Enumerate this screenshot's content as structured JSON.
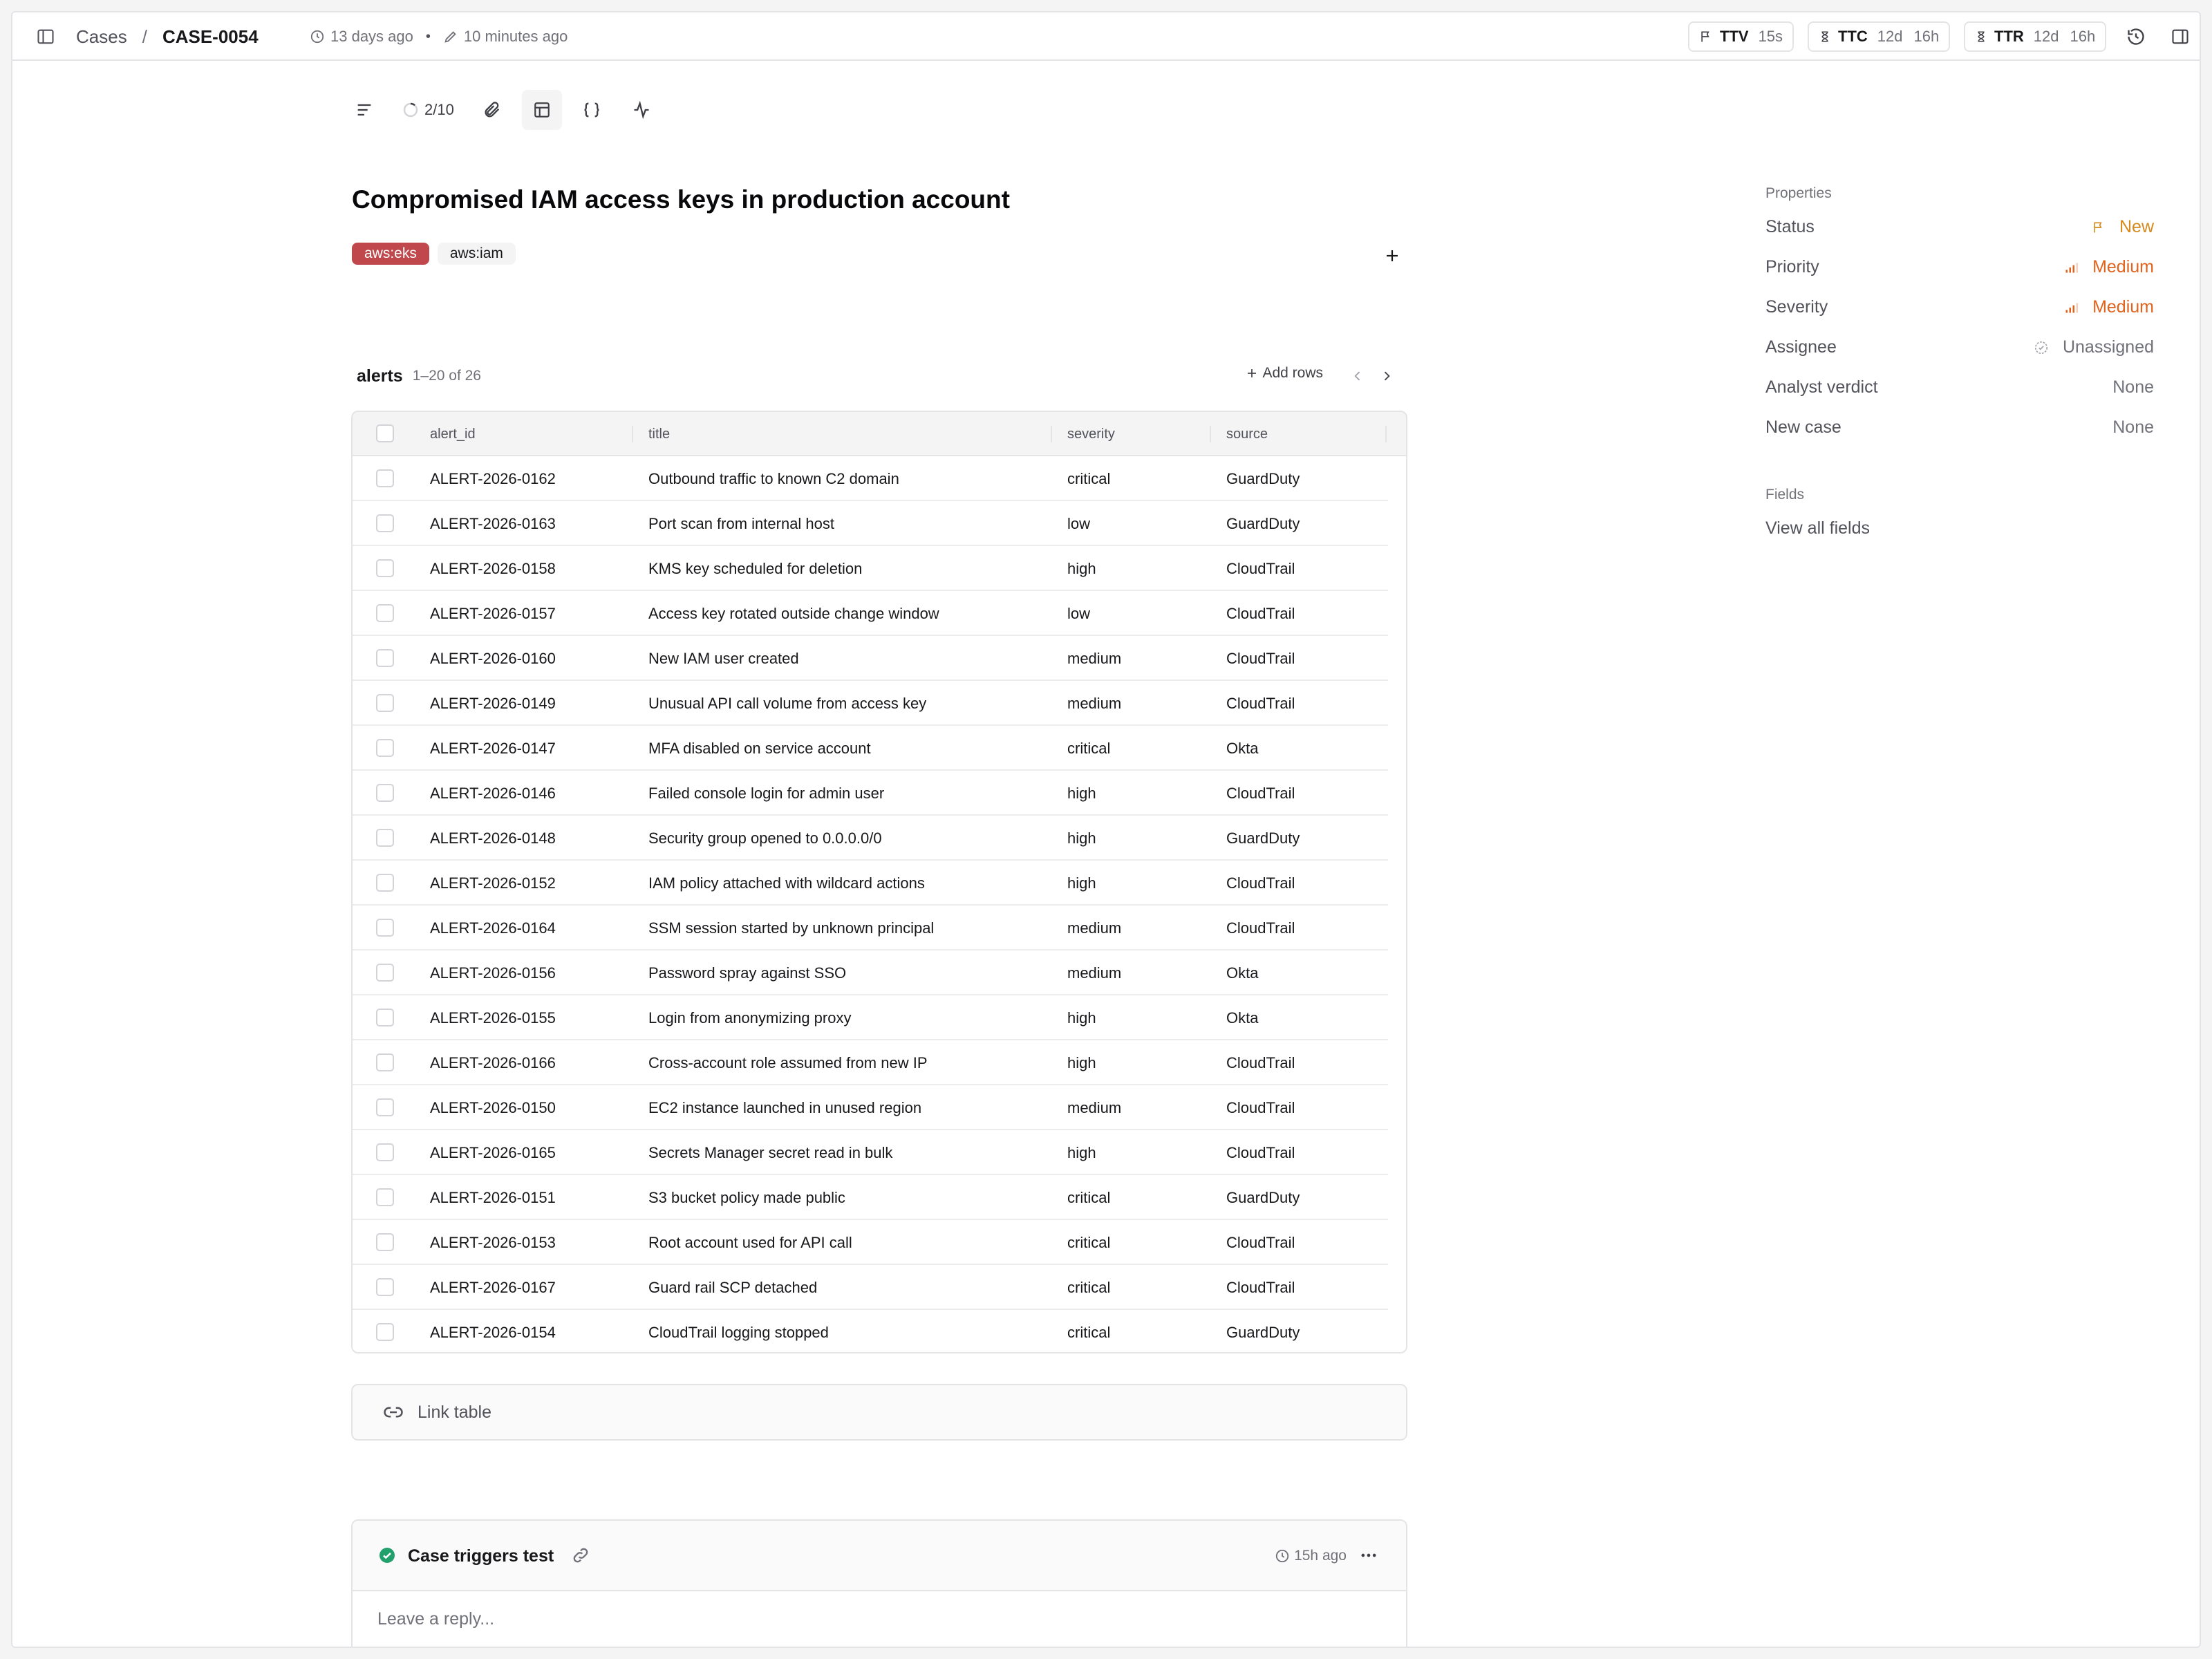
{
  "breadcrumb": {
    "parent": "Cases",
    "separator": "/",
    "current": "CASE-0054"
  },
  "meta": {
    "created": "13 days ago",
    "updated": "10 minutes ago"
  },
  "metrics": [
    {
      "label": "TTV",
      "value": "15s",
      "value2": ""
    },
    {
      "label": "TTC",
      "value": "12d",
      "value2": "16h"
    },
    {
      "label": "TTR",
      "value": "12d",
      "value2": "16h"
    }
  ],
  "toolbar": {
    "progress": "2/10"
  },
  "case": {
    "title": "Compromised IAM access keys in production account",
    "tags": [
      {
        "label": "aws:eks",
        "color": "#c0484c"
      },
      {
        "label": "aws:iam",
        "color": "#f4f4f5"
      }
    ]
  },
  "table": {
    "name": "alerts",
    "range": "1–20 of 26",
    "add_rows_label": "Add rows",
    "columns": [
      "alert_id",
      "title",
      "severity",
      "source"
    ],
    "rows": [
      [
        "ALERT-2026-0162",
        "Outbound traffic to known C2 domain",
        "critical",
        "GuardDuty"
      ],
      [
        "ALERT-2026-0163",
        "Port scan from internal host",
        "low",
        "GuardDuty"
      ],
      [
        "ALERT-2026-0158",
        "KMS key scheduled for deletion",
        "high",
        "CloudTrail"
      ],
      [
        "ALERT-2026-0157",
        "Access key rotated outside change window",
        "low",
        "CloudTrail"
      ],
      [
        "ALERT-2026-0160",
        "New IAM user created",
        "medium",
        "CloudTrail"
      ],
      [
        "ALERT-2026-0149",
        "Unusual API call volume from access key",
        "medium",
        "CloudTrail"
      ],
      [
        "ALERT-2026-0147",
        "MFA disabled on service account",
        "critical",
        "Okta"
      ],
      [
        "ALERT-2026-0146",
        "Failed console login for admin user",
        "high",
        "CloudTrail"
      ],
      [
        "ALERT-2026-0148",
        "Security group opened to 0.0.0.0/0",
        "high",
        "GuardDuty"
      ],
      [
        "ALERT-2026-0152",
        "IAM policy attached with wildcard actions",
        "high",
        "CloudTrail"
      ],
      [
        "ALERT-2026-0164",
        "SSM session started by unknown principal",
        "medium",
        "CloudTrail"
      ],
      [
        "ALERT-2026-0156",
        "Password spray against SSO",
        "medium",
        "Okta"
      ],
      [
        "ALERT-2026-0155",
        "Login from anonymizing proxy",
        "high",
        "Okta"
      ],
      [
        "ALERT-2026-0166",
        "Cross-account role assumed from new IP",
        "high",
        "CloudTrail"
      ],
      [
        "ALERT-2026-0150",
        "EC2 instance launched in unused region",
        "medium",
        "CloudTrail"
      ],
      [
        "ALERT-2026-0165",
        "Secrets Manager secret read in bulk",
        "high",
        "CloudTrail"
      ],
      [
        "ALERT-2026-0151",
        "S3 bucket policy made public",
        "critical",
        "GuardDuty"
      ],
      [
        "ALERT-2026-0153",
        "Root account used for API call",
        "critical",
        "CloudTrail"
      ],
      [
        "ALERT-2026-0167",
        "Guard rail SCP detached",
        "critical",
        "CloudTrail"
      ],
      [
        "ALERT-2026-0154",
        "CloudTrail logging stopped",
        "critical",
        "GuardDuty"
      ]
    ]
  },
  "link_table": {
    "label": "Link table"
  },
  "comment": {
    "title": "Case triggers test",
    "time": "15h ago",
    "reply_placeholder": "Leave a reply..."
  },
  "properties": {
    "section_label": "Properties",
    "items": [
      {
        "label": "Status",
        "value": "New",
        "icon": "flag-icon"
      },
      {
        "label": "Priority",
        "value": "Medium",
        "icon": "signal-bars-icon"
      },
      {
        "label": "Severity",
        "value": "Medium",
        "icon": "signal-bars-icon"
      },
      {
        "label": "Assignee",
        "value": "Unassigned",
        "icon": "unassigned-circle-icon"
      },
      {
        "label": "Analyst verdict",
        "value": "None",
        "icon": ""
      },
      {
        "label": "New case",
        "value": "None",
        "icon": ""
      }
    ]
  },
  "fields": {
    "section_label": "Fields",
    "view_all": "View all fields"
  },
  "colors": {
    "status": "#d48a1c",
    "medium": "#e0621c",
    "tag_red": "#c0484c",
    "success": "#22a06b"
  }
}
